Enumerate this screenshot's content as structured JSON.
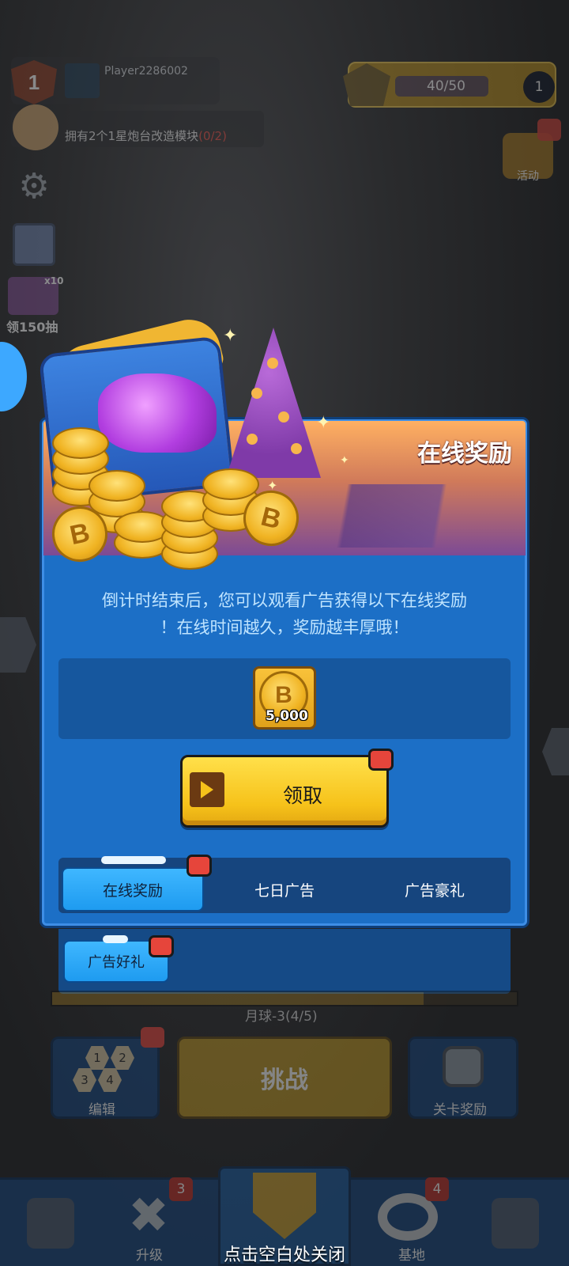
{
  "player": {
    "level": "1",
    "name": "Player2286002"
  },
  "quest": {
    "text": "拥有2个1星炮台改造模块",
    "progress": "(0/2)"
  },
  "sidebar": {
    "gacha_count": "x10",
    "gacha_label": "领150抽"
  },
  "xp": {
    "value": "40/50",
    "current": 40,
    "max": 50,
    "level": "1"
  },
  "event": {
    "label": "活动"
  },
  "modal": {
    "title": "在线奖励",
    "description_line1": "倒计时结束后，您可以观看广告获得以下在线奖励",
    "description_line2": "！在线时间越久，奖励越丰厚哦！",
    "reward_amount": "5,000",
    "claim_label": "领取",
    "tabs": [
      {
        "label": "在线奖励",
        "active": true
      },
      {
        "label": "七日广告",
        "active": false
      },
      {
        "label": "广告豪礼",
        "active": false
      }
    ],
    "sub_tab": "广告好礼"
  },
  "game": {
    "stage": "月球-3",
    "stage_progress": "(4/5)",
    "edit_label": "编辑",
    "challenge_label": "挑战",
    "stage_reward_label": "关卡奖励",
    "hex_numbers": [
      "1",
      "2",
      "3",
      "4"
    ]
  },
  "nav": {
    "upgrade_badge": "3",
    "upgrade_label": "升级",
    "base_badge": "4",
    "base_label": "基地"
  },
  "close_hint": "点击空白处关闭",
  "colors": {
    "modal_blue": "#1c6fc6",
    "claim_yellow": "#f6c21a",
    "badge_red": "#e6453b"
  }
}
